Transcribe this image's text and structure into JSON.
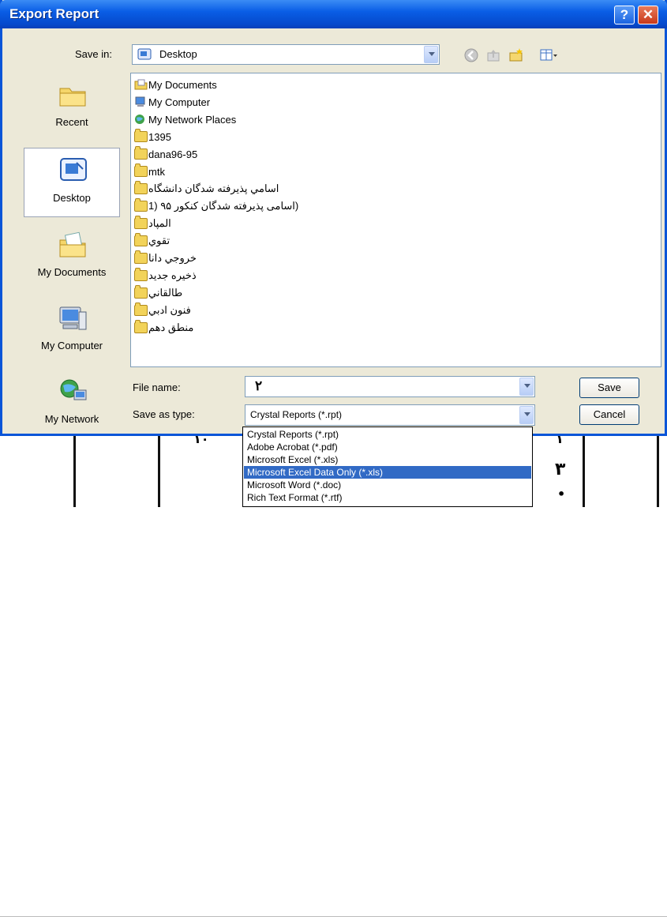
{
  "window": {
    "title": "Export Report"
  },
  "toolbar": {
    "save_in_label": "Save in:",
    "save_in_value": "Desktop",
    "icons": [
      "back-icon",
      "up-folder-icon",
      "new-folder-icon",
      "views-menu-icon"
    ]
  },
  "places": [
    {
      "label": "Recent",
      "icon": "recent-folder-icon",
      "selected": false
    },
    {
      "label": "Desktop",
      "icon": "desktop-icon",
      "selected": true
    },
    {
      "label": "My Documents",
      "icon": "my-documents-icon",
      "selected": false
    },
    {
      "label": "My Computer",
      "icon": "my-computer-icon",
      "selected": false
    },
    {
      "label": "My Network",
      "icon": "my-network-icon",
      "selected": false
    }
  ],
  "files": [
    {
      "name": "My Documents",
      "icon": "documents-folder-icon"
    },
    {
      "name": "My Computer",
      "icon": "computer-icon"
    },
    {
      "name": "My Network Places",
      "icon": "network-places-icon"
    },
    {
      "name": "1395",
      "icon": "folder-icon"
    },
    {
      "name": "dana96-95",
      "icon": "folder-icon"
    },
    {
      "name": "mtk",
      "icon": "folder-icon"
    },
    {
      "name": "اسامي پذيرفته شدگان دانشگاه",
      "icon": "folder-icon"
    },
    {
      "name": "(اسامی پذیرفته شدگان کنکور ۹۵ (1",
      "icon": "folder-icon"
    },
    {
      "name": "المپاد",
      "icon": "folder-icon"
    },
    {
      "name": "تقوي",
      "icon": "folder-icon"
    },
    {
      "name": "خروجي دانا",
      "icon": "folder-icon"
    },
    {
      "name": "ذخيره جديد",
      "icon": "folder-icon"
    },
    {
      "name": "طالقاني",
      "icon": "folder-icon"
    },
    {
      "name": "فنون ادبي",
      "icon": "folder-icon"
    },
    {
      "name": "منطق دهم",
      "icon": "folder-icon"
    }
  ],
  "form": {
    "file_name_label": "File name:",
    "file_name_value": "۲",
    "save_as_type_label": "Save as type:",
    "save_as_type_value": "Crystal Reports (*.rpt)"
  },
  "buttons": {
    "save": "Save",
    "cancel": "Cancel"
  },
  "type_options": [
    {
      "label": "Crystal Reports (*.rpt)",
      "selected": false
    },
    {
      "label": "Adobe Acrobat (*.pdf)",
      "selected": false
    },
    {
      "label": "Microsoft Excel (*.xls)",
      "selected": false
    },
    {
      "label": "Microsoft Excel Data Only (*.xls)",
      "selected": true
    },
    {
      "label": "Microsoft Word (*.doc)",
      "selected": false
    },
    {
      "label": "Rich Text Format (*.rtf)",
      "selected": false
    }
  ],
  "background_table": {
    "cells": [
      "۱۰",
      "۱",
      "۳",
      "•"
    ]
  },
  "colors": {
    "title_bar": "#0a5ee6",
    "selection": "#316ac5",
    "dialog_face": "#ece9d8"
  }
}
